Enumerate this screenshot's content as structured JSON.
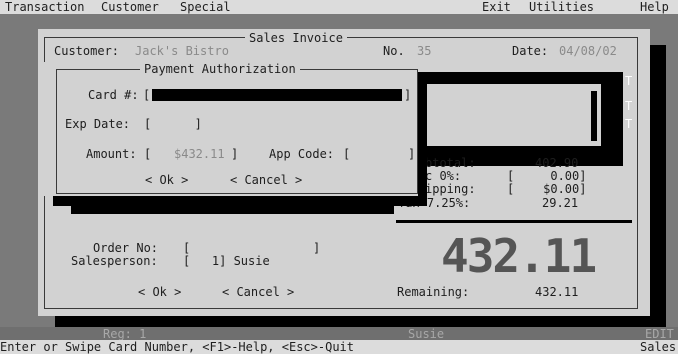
{
  "menu": {
    "left": [
      "Transaction",
      "Customer",
      "Special"
    ],
    "right": [
      "Exit",
      "Utilities",
      "Help"
    ]
  },
  "invoice": {
    "title": "Sales Invoice",
    "customer_label": "Customer:",
    "customer_value": "Jack's Bistro",
    "no_label": "No.",
    "no_value": "35",
    "date_label": "Date:",
    "date_value": "04/08/02",
    "subtotal_label": "btotal:",
    "subtotal_value": "402.90",
    "discount_label": "c 0%:",
    "discount_value": "[     0.00]",
    "shipping_label": "ipping:",
    "shipping_value": "[    $0.00]",
    "tax_label": "Tax 7.25%:",
    "tax_value": "29.21",
    "total_big": "432.11",
    "order_no_label": "Order No:",
    "order_no_value": "[                 ]",
    "salesperson_label": "Salesperson:",
    "salesperson_value": "[   1] Susie",
    "remaining_label": "Remaining:",
    "remaining_value": "432.11",
    "ok_label": "< Ok >",
    "cancel_label": "< Cancel >"
  },
  "payment": {
    "title": "Payment Authorization",
    "card_label": "Card #:",
    "card_value": "",
    "exp_label": "Exp Date:",
    "exp_value": "[      ]",
    "amount_label": "Amount:",
    "amount_value": "$432.11",
    "app_code_label": "App Code:",
    "app_code_value": "[        ]",
    "ok_label": "< Ok >",
    "cancel_label": "< Cancel >"
  },
  "status": {
    "reg": "Reg: 1",
    "user": "Susie",
    "mode": "EDIT",
    "help_text": "Enter or Swipe Card Number, <F1>-Help, <Esc>-Quit",
    "section": "Sales"
  },
  "colors": {
    "background": "#7a7a7a",
    "dialog": "#d2d2d2",
    "shadow": "#000000",
    "text": "#1e1e1e",
    "dim_text": "#8a8a8a"
  }
}
